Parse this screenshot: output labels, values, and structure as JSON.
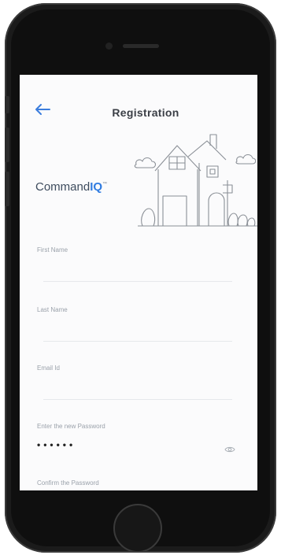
{
  "header": {
    "title": "Registration",
    "back_icon": "arrow-left-icon"
  },
  "brand": {
    "prefix": "Command",
    "suffix": "IQ",
    "mark": "™"
  },
  "form": {
    "fields": [
      {
        "label": "First Name",
        "value": ""
      },
      {
        "label": "Last Name",
        "value": ""
      },
      {
        "label": "Email Id",
        "value": ""
      },
      {
        "label": "Enter the new Password",
        "value": "••••••",
        "icon": "eye-icon"
      },
      {
        "label": "Confirm the Password",
        "value": "••••••",
        "icon": "eye-icon"
      }
    ]
  },
  "colors": {
    "accent": "#2f7be0",
    "text": "#3b3f46",
    "label": "#9aa1aa"
  }
}
